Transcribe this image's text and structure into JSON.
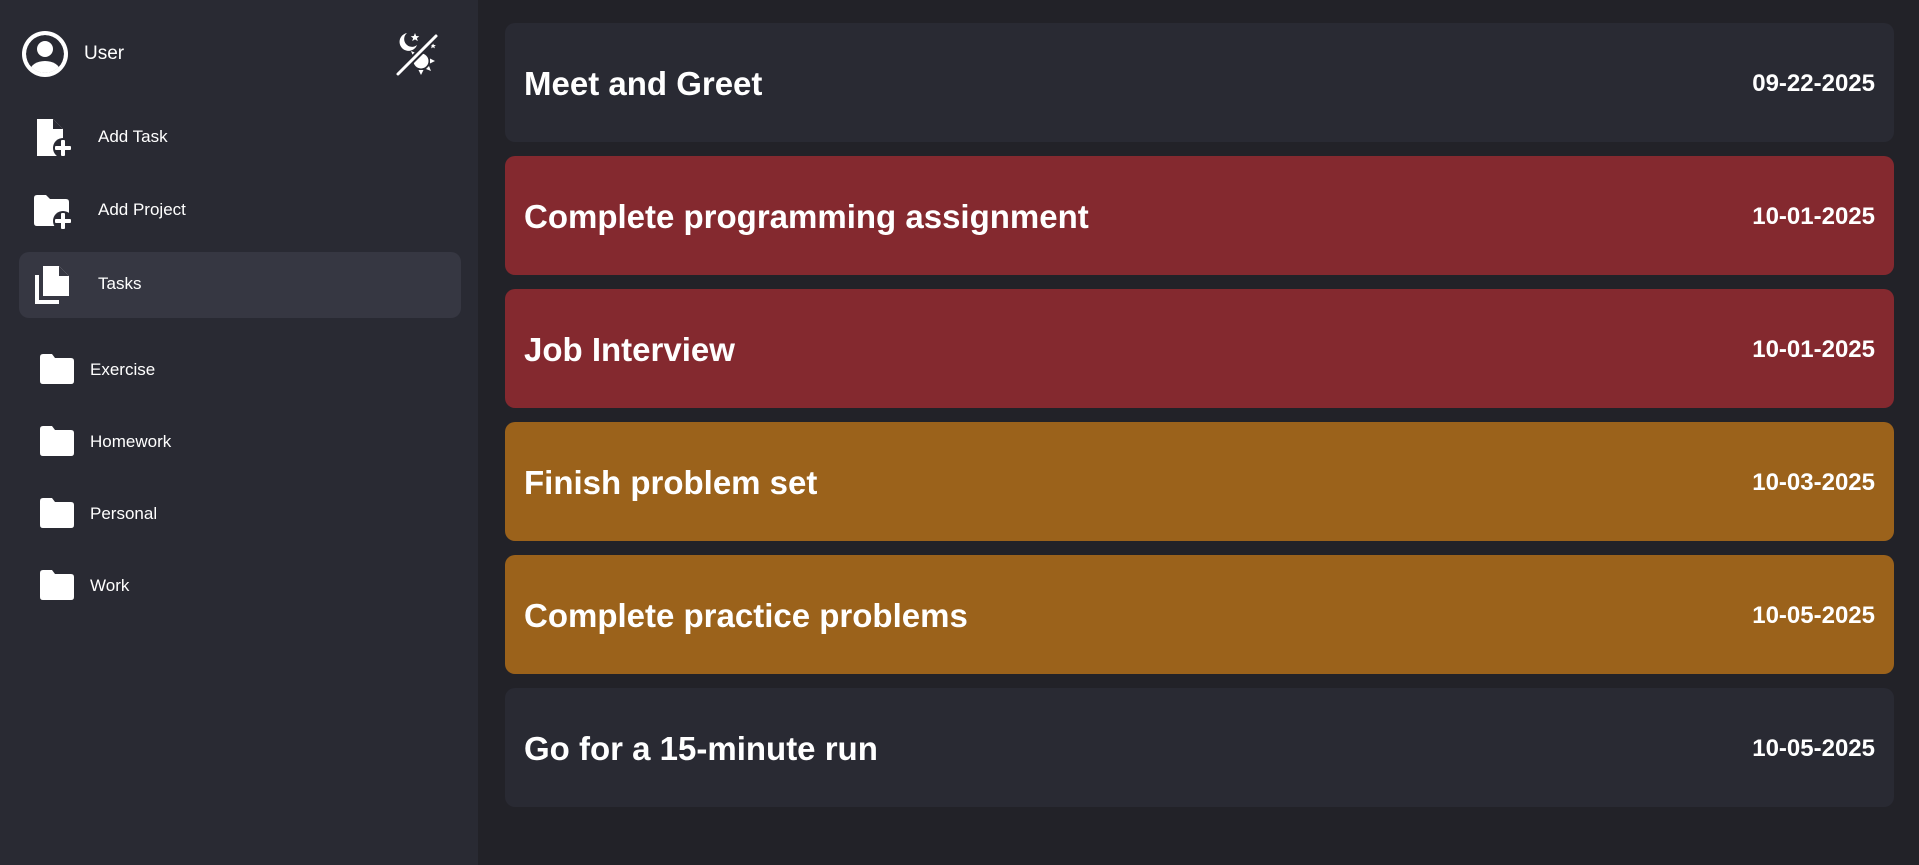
{
  "user": {
    "name": "User"
  },
  "nav": {
    "add_task": "Add Task",
    "add_project": "Add Project",
    "tasks": "Tasks"
  },
  "projects": [
    {
      "label": "Exercise"
    },
    {
      "label": "Homework"
    },
    {
      "label": "Personal"
    },
    {
      "label": "Work"
    }
  ],
  "tasks": [
    {
      "title": "Meet and Greet",
      "date": "09-22-2025",
      "color": "#292a33"
    },
    {
      "title": "Complete programming assignment",
      "date": "10-01-2025",
      "color": "#84292f"
    },
    {
      "title": "Job Interview",
      "date": "10-01-2025",
      "color": "#84292f"
    },
    {
      "title": "Finish problem set",
      "date": "10-03-2025",
      "color": "#9b621b"
    },
    {
      "title": "Complete practice problems",
      "date": "10-05-2025",
      "color": "#9b621b"
    },
    {
      "title": "Go for a 15-minute run",
      "date": "10-05-2025",
      "color": "#292a33"
    }
  ],
  "colors": {
    "background": "#222228",
    "sidebar": "#292a33",
    "active_nav": "#363742",
    "high_priority": "#84292f",
    "medium_priority": "#9b621b",
    "default_card": "#292a33"
  },
  "icons": {
    "user": "user-circle-icon",
    "theme": "theme-toggle-icon",
    "add_task": "file-plus-icon",
    "add_project": "folder-plus-icon",
    "tasks": "files-icon",
    "project": "folder-icon"
  }
}
